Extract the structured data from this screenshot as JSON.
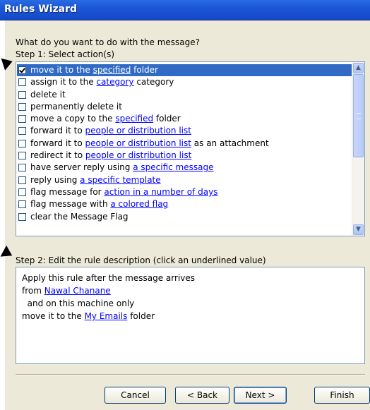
{
  "window": {
    "title": "Rules Wizard"
  },
  "prompt": "What do you want to do with the message?",
  "step1": {
    "label": "Step 1: Select action(s)",
    "actions": [
      {
        "parts": [
          "move it to the ",
          "specified",
          " folder"
        ],
        "checked": true,
        "selected": true
      },
      {
        "parts": [
          "assign it to the ",
          "category",
          " category"
        ],
        "checked": false
      },
      {
        "parts": [
          "delete it",
          "",
          ""
        ],
        "checked": false
      },
      {
        "parts": [
          "permanently delete it",
          "",
          ""
        ],
        "checked": false
      },
      {
        "parts": [
          "move a copy to the ",
          "specified",
          " folder"
        ],
        "checked": false
      },
      {
        "parts": [
          "forward it to ",
          "people or distribution list",
          ""
        ],
        "checked": false
      },
      {
        "parts": [
          "forward it to ",
          "people or distribution list",
          " as an attachment"
        ],
        "checked": false
      },
      {
        "parts": [
          "redirect it to ",
          "people or distribution list",
          ""
        ],
        "checked": false
      },
      {
        "parts": [
          "have server reply using ",
          "a specific message",
          ""
        ],
        "checked": false
      },
      {
        "parts": [
          "reply using ",
          "a specific template",
          ""
        ],
        "checked": false
      },
      {
        "parts": [
          "flag message for ",
          "action in a number of days",
          ""
        ],
        "checked": false
      },
      {
        "parts": [
          "flag message with ",
          "a colored flag",
          ""
        ],
        "checked": false
      },
      {
        "parts": [
          "clear the Message Flag",
          "",
          ""
        ],
        "checked": false
      }
    ]
  },
  "step2": {
    "label": "Step 2: Edit the rule description (click an underlined value)",
    "lines": [
      {
        "parts": [
          "Apply this rule after the message arrives",
          "",
          ""
        ]
      },
      {
        "parts": [
          "from ",
          "Nawal Chanane",
          ""
        ]
      },
      {
        "parts": [
          "  and on this machine only",
          "",
          ""
        ]
      },
      {
        "parts": [
          "move it to the ",
          "My Emails",
          " folder"
        ]
      }
    ]
  },
  "buttons": {
    "cancel": "Cancel",
    "back": "< Back",
    "next": "Next >",
    "finish": "Finish"
  },
  "colors": {
    "titlebar": "#1b57d6",
    "selection": "#316ac5",
    "link": "#0000ff",
    "dialog": "#ece9d8"
  }
}
